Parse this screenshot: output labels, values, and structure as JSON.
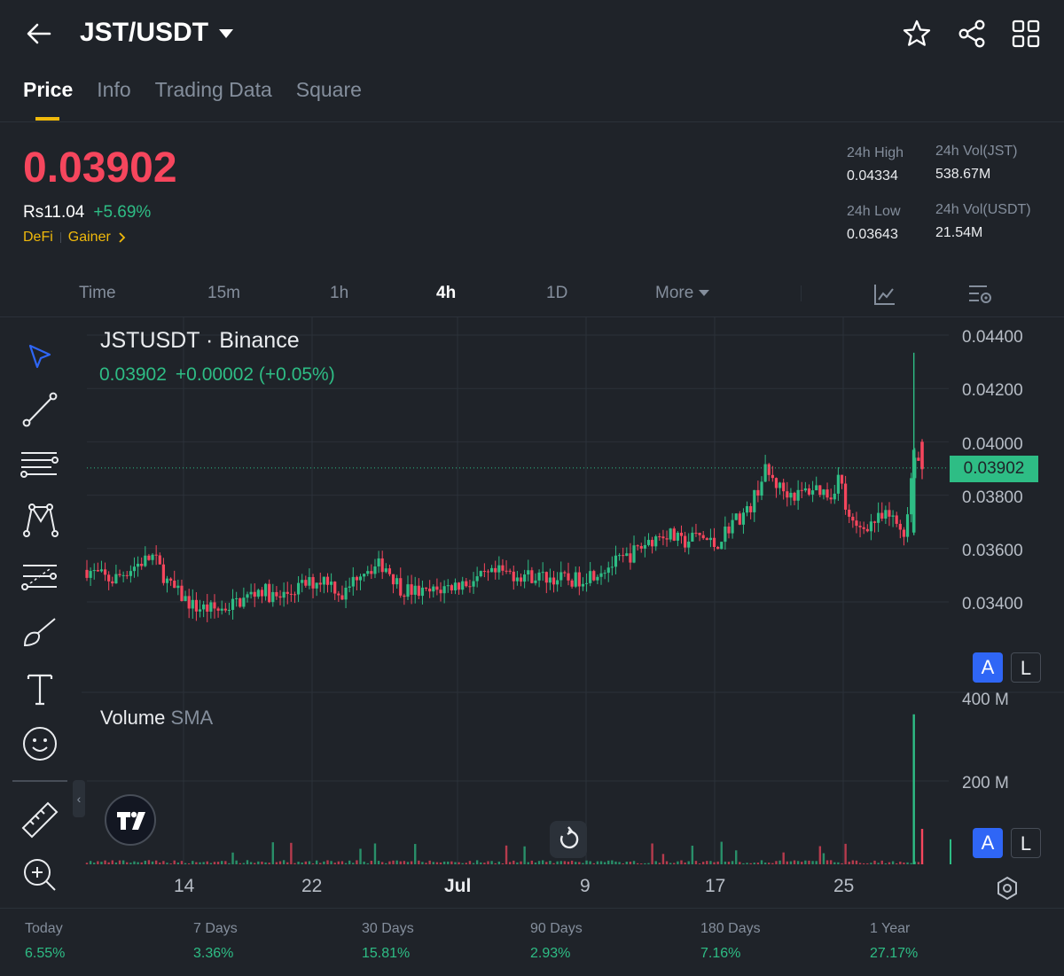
{
  "header": {
    "pair": "JST/USDT",
    "icons": [
      "back-arrow-icon",
      "star-icon",
      "share-icon",
      "grid-icon"
    ]
  },
  "tabs": [
    {
      "label": "Price",
      "active": true
    },
    {
      "label": "Info"
    },
    {
      "label": "Trading Data"
    },
    {
      "label": "Square"
    }
  ],
  "market": {
    "price": "0.03902",
    "fiat": "Rs11.04",
    "change": "+5.69%",
    "tag1": "DeFi",
    "tag2": "Gainer",
    "high_label": "24h High",
    "high": "0.04334",
    "low_label": "24h Low",
    "low": "0.03643",
    "volj_label": "24h Vol(JST)",
    "volj": "538.67M",
    "volu_label": "24h Vol(USDT)",
    "volu": "21.54M"
  },
  "intervals": {
    "time": "Time",
    "m15": "15m",
    "h1": "1h",
    "h4": "4h",
    "d1": "1D",
    "more": "More"
  },
  "chart": {
    "title": "JSTUSDT · Binance",
    "last": "0.03902",
    "delta": "+0.00002 (+0.05%)",
    "current_tag": "0.03902",
    "volume_label": "Volume",
    "volume_sub": "SMA",
    "price_axis": [
      "0.04400",
      "0.04200",
      "0.04000",
      "0.03800",
      "0.03600",
      "0.03400"
    ],
    "volume_axis": [
      "400 M",
      "200 M"
    ],
    "x_axis": [
      "14",
      "22",
      "Jul",
      "9",
      "17",
      "25"
    ],
    "btn_a": "A",
    "btn_l": "L",
    "up_color": "#2ebd85",
    "down_color": "#f6465d"
  },
  "chart_data": {
    "type": "candlestick",
    "title": "JSTUSDT · Binance",
    "x": [
      "14",
      "22",
      "Jul",
      "9",
      "17",
      "25"
    ],
    "ylim": [
      0.0332,
      0.0446
    ],
    "close_path": [
      [
        0,
        0.0352
      ],
      [
        3,
        0.0348
      ],
      [
        6,
        0.0354
      ],
      [
        8,
        0.0357
      ],
      [
        10,
        0.0346
      ],
      [
        13,
        0.0338
      ],
      [
        16,
        0.0337
      ],
      [
        19,
        0.0341
      ],
      [
        21,
        0.0345
      ],
      [
        23,
        0.0341
      ],
      [
        26,
        0.0346
      ],
      [
        29,
        0.0349
      ],
      [
        31,
        0.0342
      ],
      [
        33,
        0.0352
      ],
      [
        36,
        0.0354
      ],
      [
        38,
        0.0345
      ],
      [
        41,
        0.0343
      ],
      [
        44,
        0.0346
      ],
      [
        47,
        0.0348
      ],
      [
        50,
        0.0351
      ],
      [
        53,
        0.035
      ],
      [
        56,
        0.0349
      ],
      [
        59,
        0.0348
      ],
      [
        62,
        0.0352
      ],
      [
        65,
        0.0356
      ],
      [
        68,
        0.0363
      ],
      [
        70,
        0.0366
      ],
      [
        72,
        0.0362
      ],
      [
        74,
        0.0365
      ],
      [
        76,
        0.0361
      ],
      [
        78,
        0.037
      ],
      [
        80,
        0.0374
      ],
      [
        82,
        0.0389
      ],
      [
        84,
        0.0382
      ],
      [
        86,
        0.038
      ],
      [
        88,
        0.0383
      ],
      [
        90,
        0.038
      ],
      [
        91,
        0.0388
      ],
      [
        92,
        0.0371
      ],
      [
        93,
        0.0367
      ],
      [
        95,
        0.037
      ],
      [
        97,
        0.0372
      ],
      [
        99,
        0.0366
      ],
      [
        100,
        0.0397
      ],
      [
        101,
        0.039
      ]
    ],
    "volume_max_m": 360,
    "y_axis_ticks": [
      0.044,
      0.042,
      0.04,
      0.038,
      0.036,
      0.034
    ]
  },
  "performance": [
    {
      "label": "Today",
      "value": "6.55%"
    },
    {
      "label": "7 Days",
      "value": "3.36%"
    },
    {
      "label": "30 Days",
      "value": "15.81%"
    },
    {
      "label": "90 Days",
      "value": "2.93%"
    },
    {
      "label": "180 Days",
      "value": "7.16%"
    },
    {
      "label": "1 Year",
      "value": "27.17%"
    }
  ]
}
